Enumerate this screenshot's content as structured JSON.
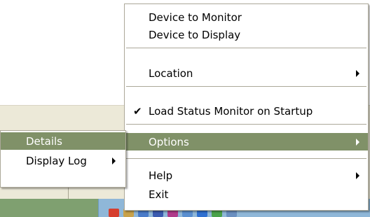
{
  "menu": {
    "items": [
      {
        "label": "Device to Monitor"
      },
      {
        "label": "Device to Display"
      },
      {
        "label": "Location"
      },
      {
        "label": "Load Status Monitor on Startup",
        "checked": true
      },
      {
        "label": "Options"
      },
      {
        "label": "Help"
      },
      {
        "label": "Exit"
      }
    ]
  },
  "submenu": {
    "items": [
      {
        "label": "Details"
      },
      {
        "label": "Display Log"
      }
    ]
  },
  "colors": {
    "highlight": "#809168",
    "menu_border": "#aca899",
    "taskbar": "#3a6ea5"
  },
  "icons": {
    "check": "check-icon",
    "submenu_arrow": "chevron-right-icon"
  }
}
